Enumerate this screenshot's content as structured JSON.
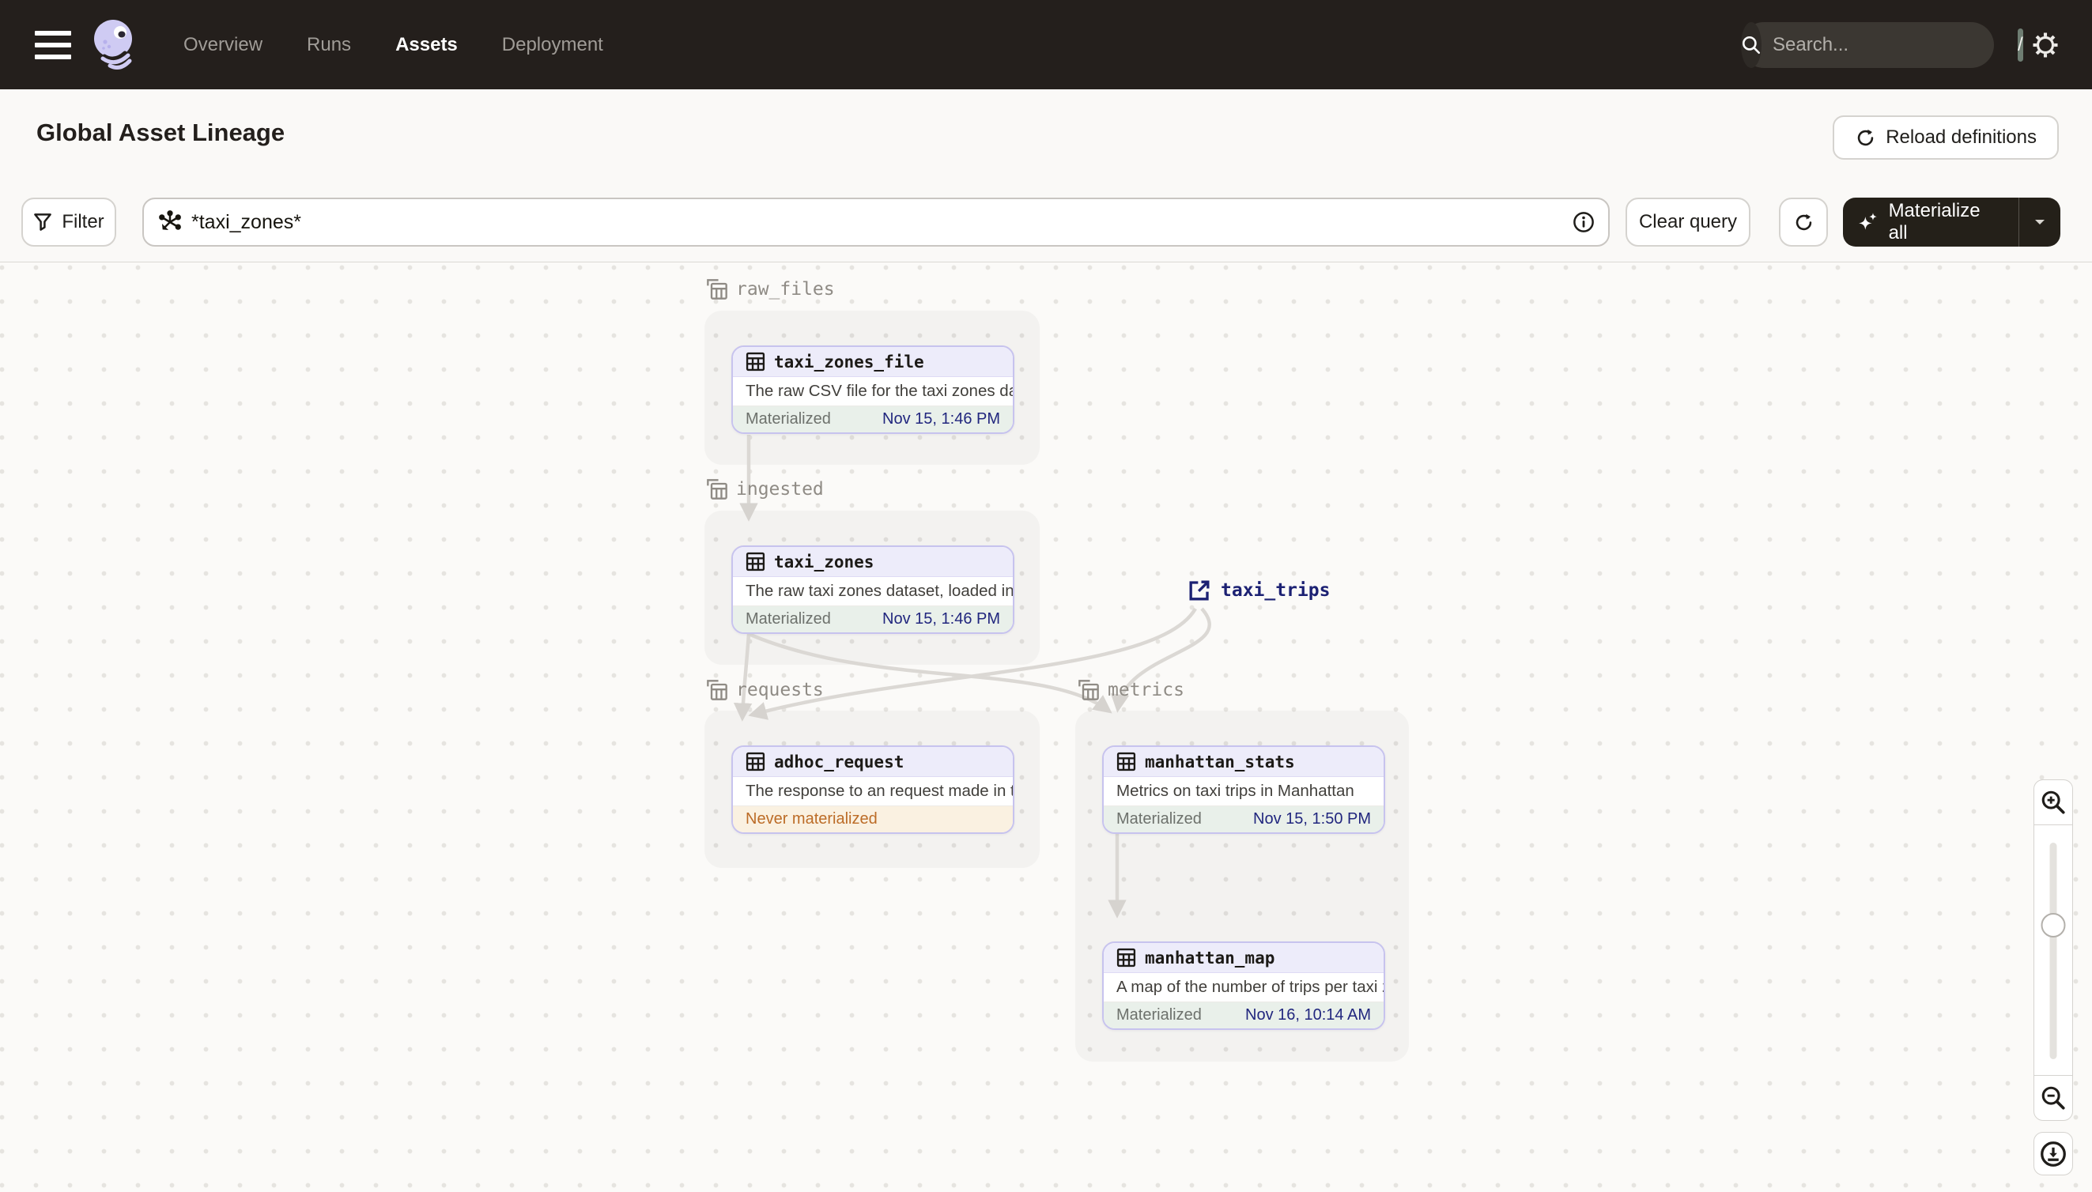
{
  "nav": {
    "items": [
      {
        "label": "Overview",
        "active": false
      },
      {
        "label": "Runs",
        "active": false
      },
      {
        "label": "Assets",
        "active": true
      },
      {
        "label": "Deployment",
        "active": false
      }
    ],
    "search": {
      "placeholder": "Search...",
      "shortcut": "/"
    }
  },
  "header": {
    "title": "Global Asset Lineage",
    "reload_button": "Reload definitions"
  },
  "toolbar": {
    "filter_label": "Filter",
    "query_value": "*taxi_zones*",
    "clear_button": "Clear query",
    "materialize_button": "Materialize all"
  },
  "graph": {
    "groups": [
      {
        "name": "raw_files"
      },
      {
        "name": "ingested"
      },
      {
        "name": "requests"
      },
      {
        "name": "metrics"
      }
    ],
    "nodes": [
      {
        "name": "taxi_zones_file",
        "group": "raw_files",
        "description": "The raw CSV file for the taxi zones dat...",
        "status": "Materialized",
        "timestamp": "Nov 15, 1:46 PM"
      },
      {
        "name": "taxi_zones",
        "group": "ingested",
        "description": "The raw taxi zones dataset, loaded int...",
        "status": "Materialized",
        "timestamp": "Nov 15, 1:46 PM"
      },
      {
        "name": "adhoc_request",
        "group": "requests",
        "description": "The response to an request made in th...",
        "status": "Never materialized",
        "timestamp": ""
      },
      {
        "name": "manhattan_stats",
        "group": "metrics",
        "description": "Metrics on taxi trips in Manhattan",
        "status": "Materialized",
        "timestamp": "Nov 15, 1:50 PM"
      },
      {
        "name": "manhattan_map",
        "group": "metrics",
        "description": "A map of the number of trips per taxi z...",
        "status": "Materialized",
        "timestamp": "Nov 16, 10:14 AM"
      }
    ],
    "external_assets": [
      {
        "name": "taxi_trips"
      }
    ],
    "edges": [
      [
        "taxi_zones_file",
        "taxi_zones"
      ],
      [
        "taxi_zones",
        "adhoc_request"
      ],
      [
        "taxi_zones",
        "manhattan_stats"
      ],
      [
        "taxi_trips",
        "adhoc_request"
      ],
      [
        "taxi_trips",
        "manhattan_stats"
      ],
      [
        "manhattan_stats",
        "manhattan_map"
      ]
    ]
  },
  "colors": {
    "nav_bg": "#241f1c",
    "accent_purple": "#c7c3ee",
    "node_header_bg": "#edecfa",
    "materialized_bg": "#e9f0ea",
    "timestamp_navy": "#21267e",
    "never_materialized_bg": "#faf1e1",
    "never_materialized_text": "#bc6c27",
    "edge_gray": "#dbd8d4",
    "external_asset_navy": "#1c2173"
  }
}
